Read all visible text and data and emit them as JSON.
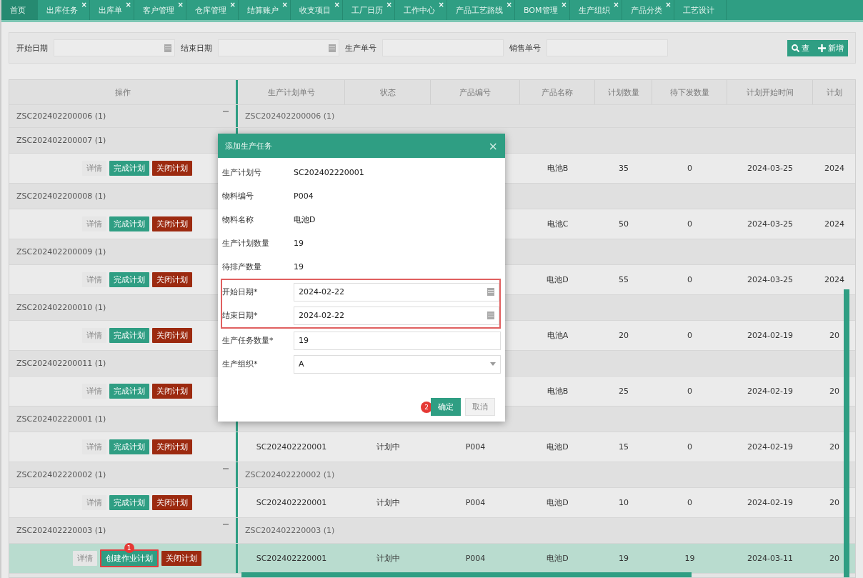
{
  "tabs": [
    {
      "label": "首页",
      "selected": true
    },
    {
      "label": "出库任务",
      "close": "×",
      "selected": false
    },
    {
      "label": "出库单",
      "close": "×",
      "selected": false
    },
    {
      "label": "客户管理",
      "close": "×",
      "selected": false
    },
    {
      "label": "仓库管理",
      "close": "×",
      "selected": false
    },
    {
      "label": "结算账户",
      "close": "×",
      "selected": false
    },
    {
      "label": "收支项目",
      "close": "×",
      "selected": false
    },
    {
      "label": "工厂日历",
      "close": "×",
      "selected": false
    },
    {
      "label": "工作中心",
      "close": "×",
      "selected": false
    },
    {
      "label": "产品工艺路线",
      "close": "×",
      "selected": false
    },
    {
      "label": "BOM管理",
      "close": "×",
      "selected": false
    },
    {
      "label": "生产组织",
      "close": "×",
      "selected": false
    },
    {
      "label": "产品分类",
      "close": "×",
      "selected": false
    },
    {
      "label": "工艺设计",
      "selected": false
    }
  ],
  "filters": [
    {
      "label": "开始日期",
      "kind": "date"
    },
    {
      "label": "结束日期",
      "kind": "date"
    },
    {
      "label": "生产单号",
      "kind": "text"
    },
    {
      "label": "销售单号",
      "kind": "text"
    }
  ],
  "filter_buttons": [
    {
      "label": "查",
      "kind": "search"
    },
    {
      "label": "新增",
      "kind": "add"
    }
  ],
  "table": {
    "action_column": "操作",
    "columns": [
      "生产计划单号",
      "状态",
      "产品编号",
      "产品名称",
      "计划数量",
      "待下发数量",
      "计划开始时间",
      "计划"
    ],
    "groups": [
      {
        "title": "ZSC202402200006 (1)",
        "right_title": "ZSC202402200006 (1)",
        "show_toggle": true
      },
      {
        "title": "ZSC202402200007 (1)",
        "row": {
          "selected": false,
          "actions": [
            {
              "label": "详情",
              "kind": "detail",
              "highlighted": false
            },
            {
              "label": "完成计划",
              "kind": "complete",
              "highlighted": false
            },
            {
              "label": "关闭计划",
              "kind": "close",
              "highlighted": false
            }
          ],
          "cells": [
            null,
            null,
            null,
            "电池B",
            "35",
            "0",
            "2024-03-25",
            "2024"
          ]
        }
      },
      {
        "title": "ZSC202402200008 (1)",
        "row": {
          "selected": false,
          "actions": [
            {
              "label": "详情",
              "kind": "detail",
              "highlighted": false
            },
            {
              "label": "完成计划",
              "kind": "complete",
              "highlighted": false
            },
            {
              "label": "关闭计划",
              "kind": "close",
              "highlighted": false
            }
          ],
          "cells": [
            null,
            null,
            null,
            "电池C",
            "50",
            "0",
            "2024-03-25",
            "2024"
          ]
        }
      },
      {
        "title": "ZSC202402200009 (1)",
        "row": {
          "selected": false,
          "actions": [
            {
              "label": "详情",
              "kind": "detail",
              "highlighted": false
            },
            {
              "label": "完成计划",
              "kind": "complete",
              "highlighted": false
            },
            {
              "label": "关闭计划",
              "kind": "close",
              "highlighted": false
            }
          ],
          "cells": [
            null,
            null,
            null,
            "电池D",
            "55",
            "0",
            "2024-03-25",
            "2024"
          ]
        }
      },
      {
        "title": "ZSC202402200010 (1)",
        "row": {
          "selected": false,
          "actions": [
            {
              "label": "详情",
              "kind": "detail",
              "highlighted": false
            },
            {
              "label": "完成计划",
              "kind": "complete",
              "highlighted": false
            },
            {
              "label": "关闭计划",
              "kind": "close",
              "highlighted": false
            }
          ],
          "cells": [
            null,
            null,
            null,
            "电池A",
            "20",
            "0",
            "2024-02-19",
            "20"
          ]
        }
      },
      {
        "title": "ZSC202402200011 (1)",
        "row": {
          "selected": false,
          "actions": [
            {
              "label": "详情",
              "kind": "detail",
              "highlighted": false
            },
            {
              "label": "完成计划",
              "kind": "complete",
              "highlighted": false
            },
            {
              "label": "关闭计划",
              "kind": "close",
              "highlighted": false
            }
          ],
          "cells": [
            null,
            null,
            null,
            "电池B",
            "25",
            "0",
            "2024-02-19",
            "20"
          ]
        }
      },
      {
        "title": "ZSC202402220001 (1)",
        "row": {
          "selected": false,
          "actions": [
            {
              "label": "详情",
              "kind": "detail",
              "highlighted": false
            },
            {
              "label": "完成计划",
              "kind": "complete",
              "highlighted": false
            },
            {
              "label": "关闭计划",
              "kind": "close",
              "highlighted": false
            }
          ],
          "cells": [
            "SC202402220001",
            "计划中",
            "P004",
            "电池D",
            "15",
            "0",
            "2024-02-19",
            "20"
          ]
        }
      },
      {
        "title": "ZSC202402220002 (1)",
        "right_title": "ZSC202402220002 (1)",
        "show_toggle": true,
        "row": {
          "selected": false,
          "actions": [
            {
              "label": "详情",
              "kind": "detail",
              "highlighted": false
            },
            {
              "label": "完成计划",
              "kind": "complete",
              "highlighted": false
            },
            {
              "label": "关闭计划",
              "kind": "close",
              "highlighted": false
            }
          ],
          "cells": [
            "SC202402220001",
            "计划中",
            "P004",
            "电池D",
            "10",
            "0",
            "2024-02-19",
            "20"
          ]
        }
      },
      {
        "title": "ZSC202402220003 (1)",
        "right_title": "ZSC202402220003 (1)",
        "show_toggle": true,
        "row": {
          "selected": true,
          "actions": [
            {
              "label": "详情",
              "kind": "detail",
              "highlighted": false
            },
            {
              "label": "创建作业计划",
              "kind": "complete",
              "highlighted": true,
              "badge": "1"
            },
            {
              "label": "关闭计划",
              "kind": "close",
              "highlighted": false
            }
          ],
          "cells": [
            "SC202402220001",
            "计划中",
            "P004",
            "电池D",
            "19",
            "19",
            "2024-03-11",
            "20"
          ]
        }
      }
    ]
  },
  "dialog": {
    "title": "添加生产任务",
    "close": "×",
    "fields": [
      {
        "label": "生产计划号",
        "kind": "text",
        "value": "SC202402220001",
        "highlighted": false
      },
      {
        "label": "物料编号",
        "kind": "text",
        "value": "P004",
        "highlighted": false
      },
      {
        "label": "物料名称",
        "kind": "text",
        "value": "电池D",
        "highlighted": false
      },
      {
        "label": "生产计划数量",
        "kind": "text",
        "value": "19",
        "highlighted": false
      },
      {
        "label": "待排产数量",
        "kind": "text",
        "value": "19",
        "highlighted": false
      },
      {
        "label": "开始日期*",
        "kind": "date",
        "value": "2024-02-22",
        "highlighted": true
      },
      {
        "label": "结束日期*",
        "kind": "date",
        "value": "2024-02-22",
        "highlighted": true
      },
      {
        "label": "生产任务数量*",
        "kind": "input",
        "value": "19",
        "highlighted": false
      },
      {
        "label": "生产组织*",
        "kind": "select",
        "value": "A",
        "highlighted": false
      }
    ],
    "buttons": [
      {
        "label": "确定",
        "kind": "primary",
        "badge": "2"
      },
      {
        "label": "取消",
        "kind": "secondary"
      }
    ]
  }
}
